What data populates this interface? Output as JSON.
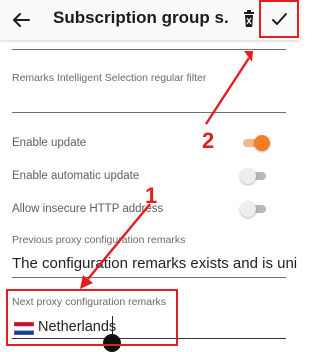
{
  "appbar": {
    "title": "Subscription group s...",
    "back_icon": "arrow-left-icon",
    "delete_icon": "trash-icon",
    "confirm_icon": "check-icon"
  },
  "fields": {
    "remarks_filter": {
      "label": "Remarks Intelligent Selection regular filter",
      "value": ""
    },
    "previous_proxy": {
      "label": "Previous proxy configuration remarks",
      "value": "The configuration remarks exists and is uni"
    },
    "next_proxy": {
      "label": "Next proxy configuration remarks",
      "flag_icon": "netherlands-flag-icon",
      "value": "Netherlands"
    }
  },
  "settings": [
    {
      "label": "Enable update",
      "enabled": true
    },
    {
      "label": "Enable automatic update",
      "enabled": false
    },
    {
      "label": "Allow insecure HTTP address",
      "enabled": false
    }
  ],
  "annotations": {
    "first": "1",
    "second": "2"
  },
  "colors": {
    "accent": "#f47c25",
    "annotation": "#e41e1e"
  }
}
